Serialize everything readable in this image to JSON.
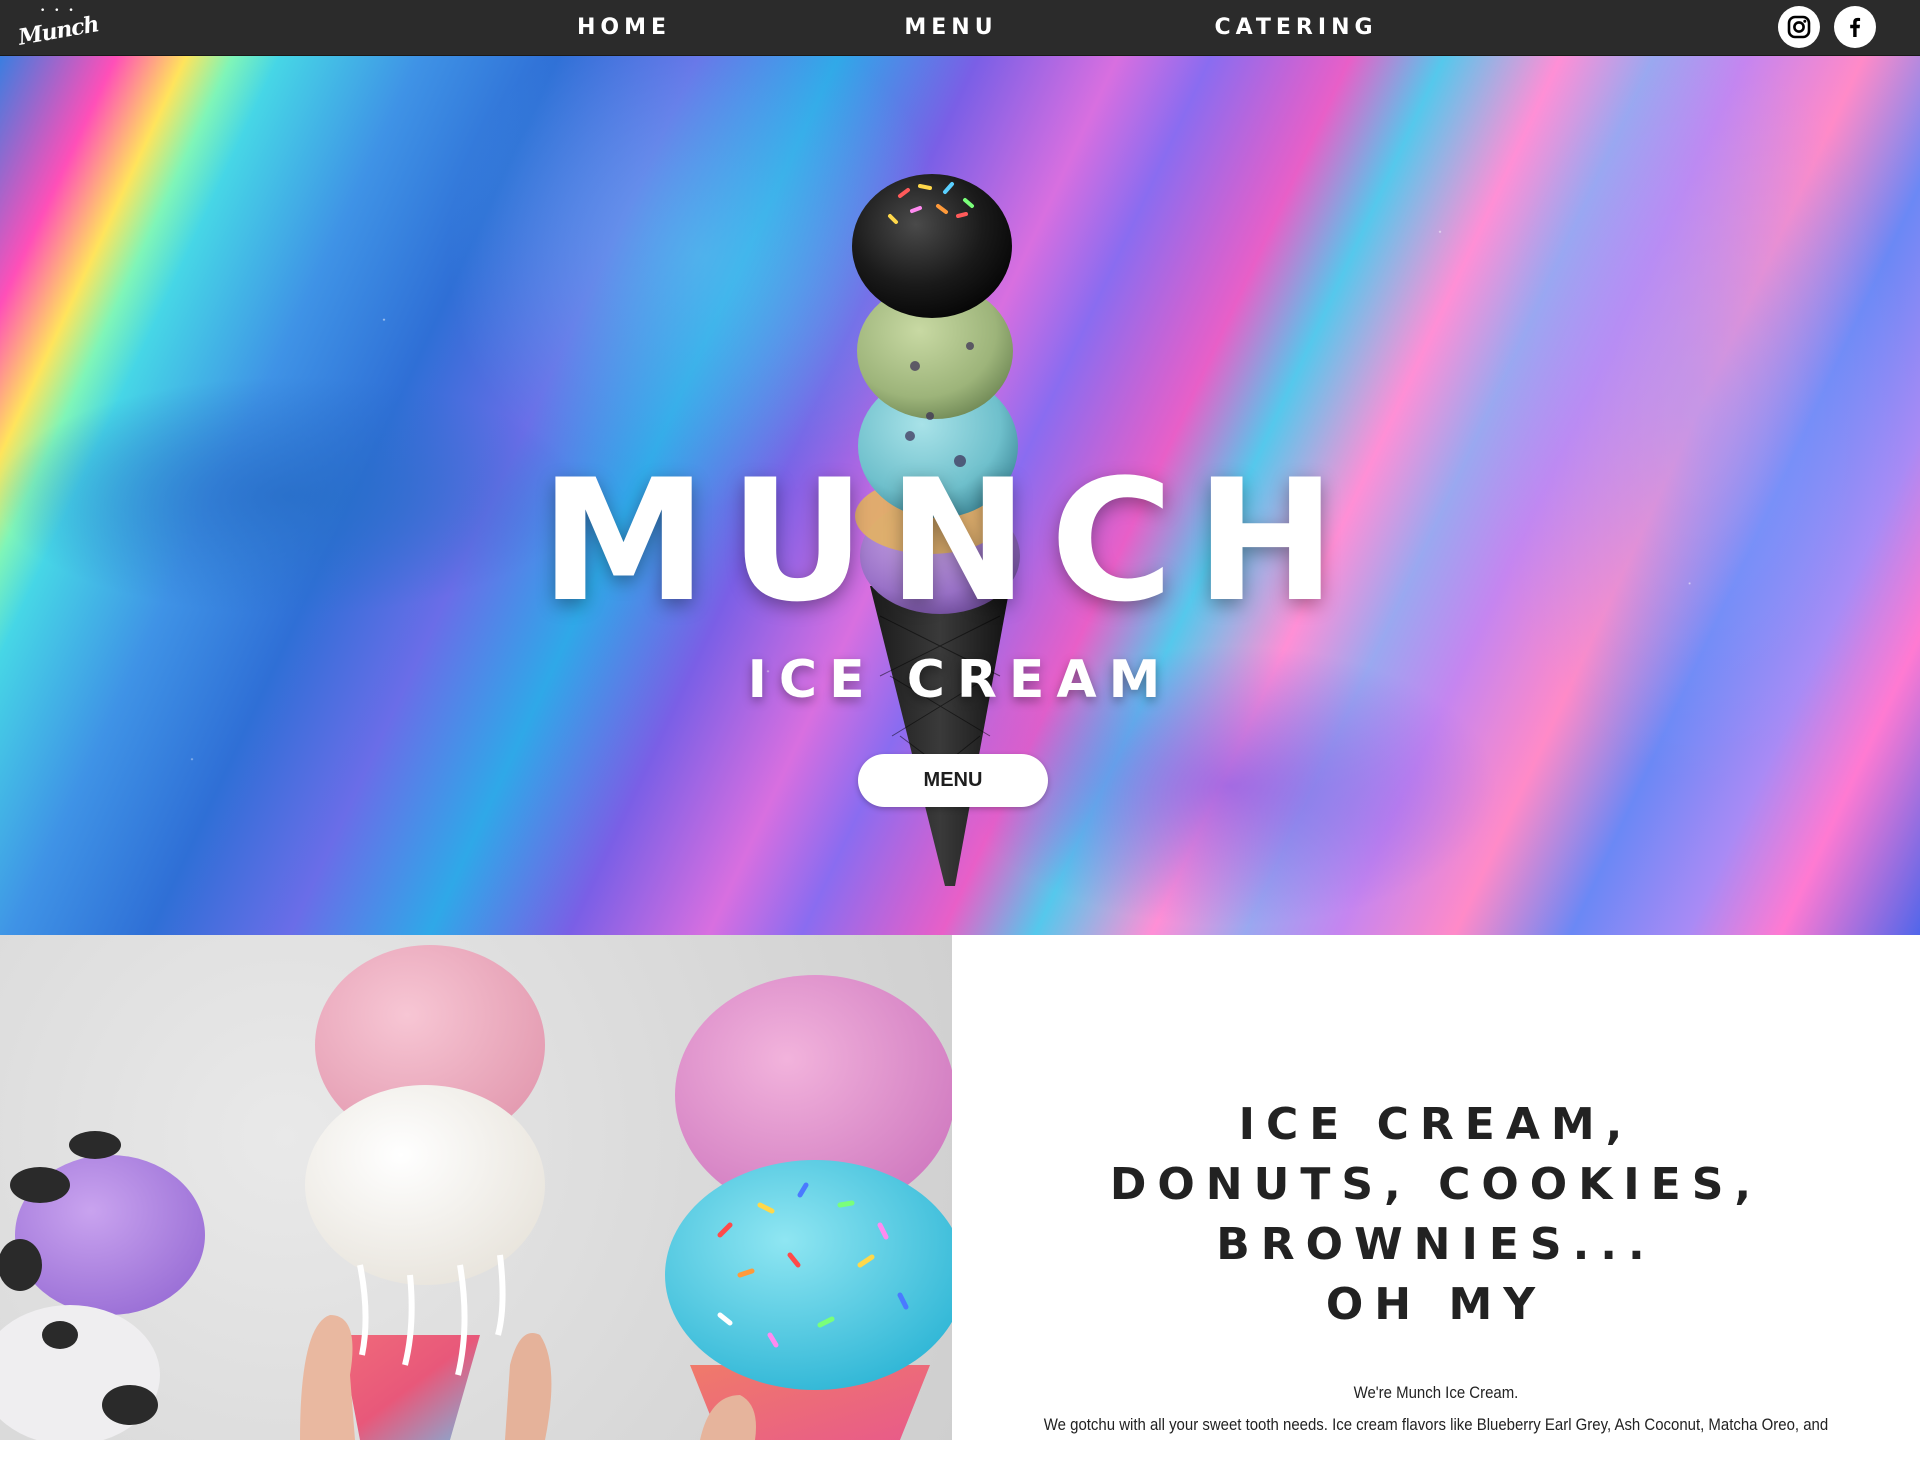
{
  "nav": {
    "logo_text": "Munch",
    "items": [
      {
        "label": "HOME"
      },
      {
        "label": "MENU"
      },
      {
        "label": "CATERING"
      }
    ],
    "social": [
      {
        "icon": "instagram-icon"
      },
      {
        "icon": "facebook-icon"
      }
    ]
  },
  "hero": {
    "title": "MUNCH",
    "subtitle": "ICE CREAM",
    "button_label": "MENU"
  },
  "about": {
    "headline_lines": [
      "ICE CREAM,",
      "DONUTS, COOKIES,",
      "BROWNIES...",
      "OH MY"
    ],
    "intro": "We're Munch Ice Cream.",
    "body": "We gotchu with all your sweet tooth needs. Ice cream flavors like Blueberry Earl Grey, Ash Coconut, Matcha Oreo, and"
  },
  "colors": {
    "navbar_bg": "#2b2b2b",
    "text_dark": "#222222",
    "button_bg": "#ffffff"
  }
}
